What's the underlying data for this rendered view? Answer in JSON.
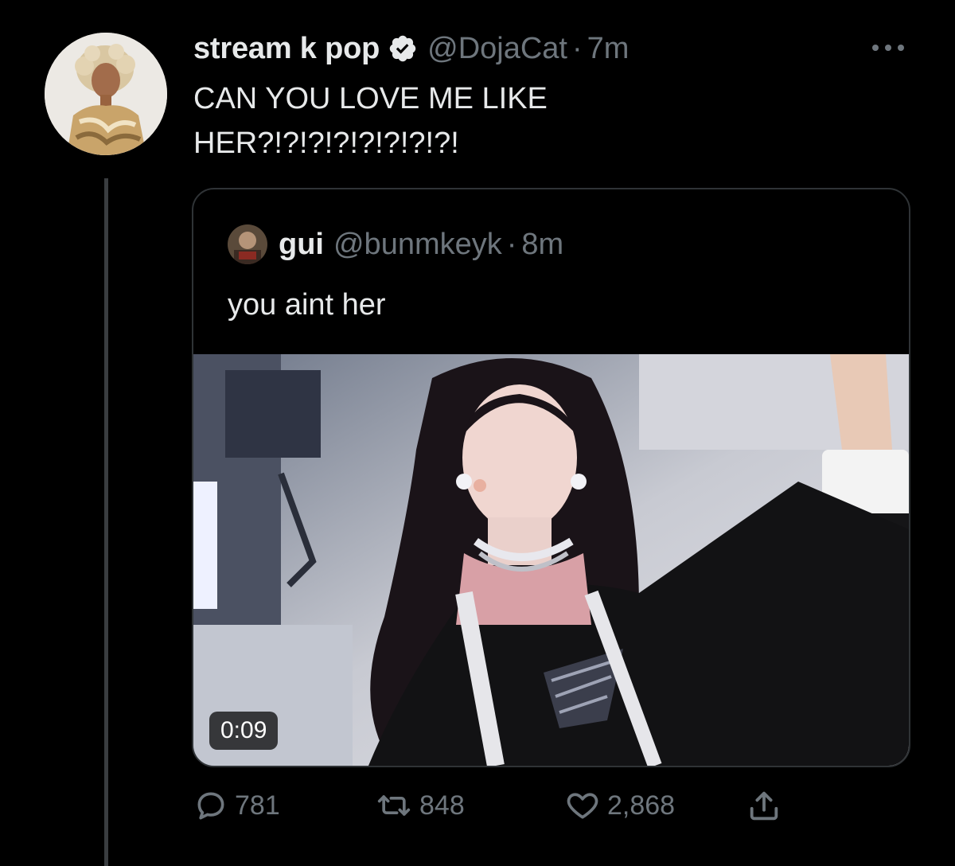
{
  "tweet": {
    "display_name": "stream k pop",
    "handle": "@DojaCat",
    "separator": "·",
    "time": "7m",
    "text": "CAN YOU LOVE ME LIKE\nHER?!?!?!?!?!?!?!?!"
  },
  "quoted_tweet": {
    "display_name": "gui",
    "handle": "@bunmkeyk",
    "separator": "·",
    "time": "8m",
    "text": "you aint her",
    "video_duration": "0:09"
  },
  "actions": {
    "replies": "781",
    "retweets": "848",
    "likes": "2,868"
  },
  "icons": {
    "verified": "verified-badge-icon",
    "more": "more-options-icon",
    "reply": "reply-icon",
    "retweet": "retweet-icon",
    "like": "heart-icon",
    "share": "share-icon"
  },
  "colors": {
    "background": "#000000",
    "primary_text": "#e7e9ea",
    "secondary_text": "#6e767d",
    "border": "#2f3336",
    "thread_line": "#3a3d40"
  }
}
